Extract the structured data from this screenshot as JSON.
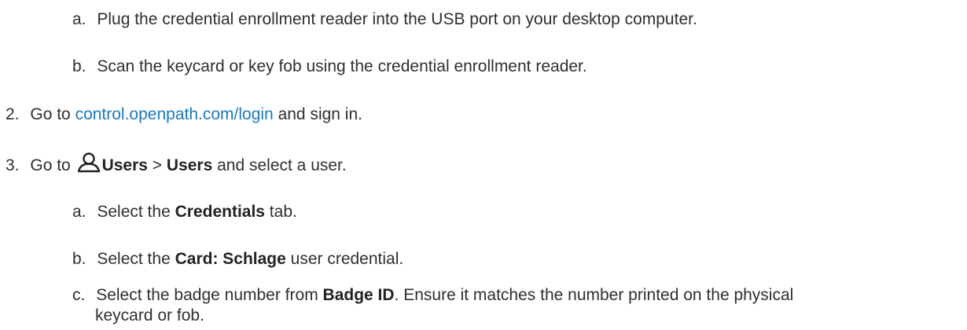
{
  "steps": {
    "s1a": {
      "marker": "a.",
      "text": "Plug the credential enrollment reader into the USB port on your desktop computer."
    },
    "s1b": {
      "marker": "b.",
      "text": "Scan the keycard or key fob using the credential enrollment reader."
    },
    "s2": {
      "marker": "2.",
      "pre": "Go to ",
      "link": "control.openpath.com/login",
      "post": " and sign in."
    },
    "s3": {
      "marker": "3.",
      "pre": "Go to ",
      "icon": "user-icon",
      "b1": "Users",
      "mid": " > ",
      "b2": "Users",
      "post": " and select a user."
    },
    "s3a": {
      "marker": "a.",
      "pre": "Select the ",
      "bold": "Credentials",
      "post": " tab."
    },
    "s3b": {
      "marker": "b.",
      "pre": "Select the ",
      "bold": "Card: Schlage",
      "post": " user credential."
    },
    "s3c": {
      "marker": "c.",
      "pre": "Select the badge number from ",
      "bold": "Badge ID",
      "post": ". Ensure it matches the number printed on the physical",
      "cont": "keycard or fob."
    }
  }
}
